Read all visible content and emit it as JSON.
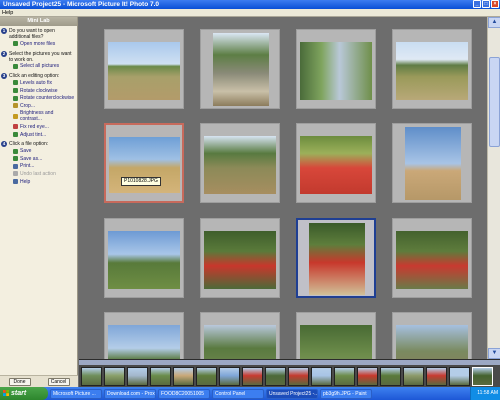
{
  "window": {
    "title": "Unsaved Project25 - Microsoft Picture It! Photo 7.0"
  },
  "menu": {
    "help_label": "Help"
  },
  "taskpane": {
    "header": "Mini Lab",
    "steps": [
      {
        "num": "1",
        "title": "Do you want to open additional files?",
        "links": [
          {
            "label": "Open more files",
            "color": "#3a8a3a"
          }
        ]
      },
      {
        "num": "2",
        "title": "Select the pictures you want to work on.",
        "links": [
          {
            "label": "Select all pictures",
            "color": "#3a8a3a"
          }
        ]
      },
      {
        "num": "3",
        "title": "Click an editing option:",
        "links": [
          {
            "label": "Levels auto fix",
            "color": "#3a8a3a"
          },
          {
            "label": "Rotate clockwise",
            "color": "#3a8a3a"
          },
          {
            "label": "Rotate counterclockwise",
            "color": "#3a8a3a"
          },
          {
            "label": "Crop...",
            "color": "#b5932a"
          },
          {
            "label": "Brightness and contrast...",
            "color": "#c49a1e"
          },
          {
            "label": "Fix red eye...",
            "color": "#c04040"
          },
          {
            "label": "Adjust tint...",
            "color": "#3a8a3a"
          }
        ]
      },
      {
        "num": "4",
        "title": "Click a file option:",
        "links": [
          {
            "label": "Save",
            "color": "#3a8a3a"
          },
          {
            "label": "Save as...",
            "color": "#3a8a3a"
          },
          {
            "label": "Print...",
            "color": "#4a6aa0"
          },
          {
            "label": "Undo last action",
            "color": "#aaaaaa",
            "disabled": true
          },
          {
            "label": "Help",
            "color": "#4a6aa0"
          }
        ]
      }
    ],
    "buttons": {
      "done": "Done",
      "cancel": "Cancel"
    }
  },
  "gallery": {
    "tooltip": "P1010828.JPG"
  },
  "taskbar": {
    "start": "start",
    "buttons": [
      "Microsoft Picture ...",
      "Download.com - Prox...",
      "FOOD8C20051005",
      "Control Panel",
      "Unsaved Project25 -...",
      "pb3g9h.JPG - Paint"
    ],
    "active_index": 4,
    "clock": "11:58 AM"
  }
}
